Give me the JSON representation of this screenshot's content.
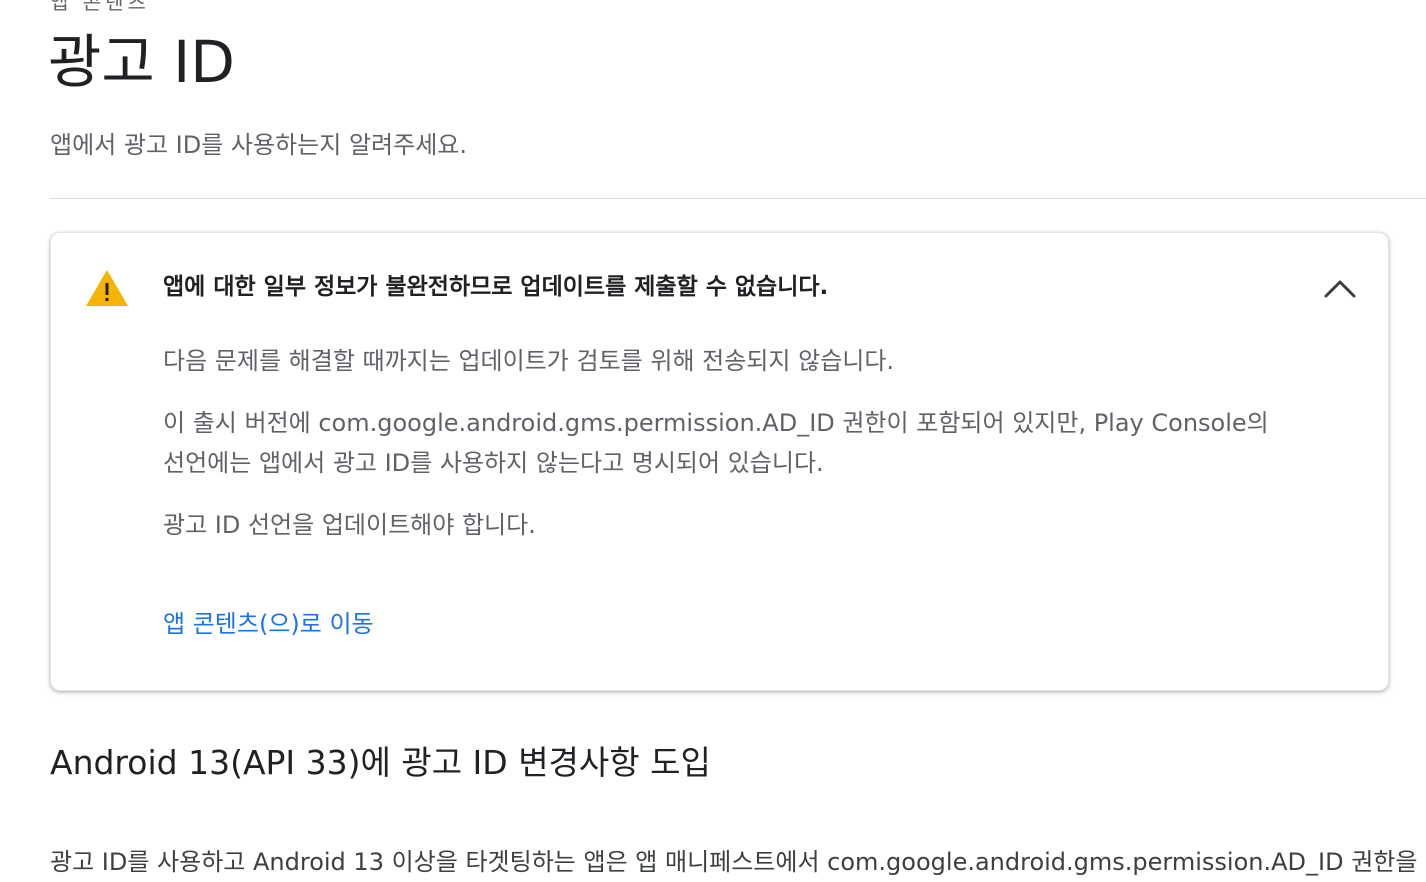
{
  "breadcrumb": {
    "label": "앱 콘텐츠"
  },
  "header": {
    "title": "광고 ID",
    "subtitle": "앱에서 광고 ID를 사용하는지 알려주세요."
  },
  "warning": {
    "icon": "warning-icon",
    "icon_color": "#f4b400",
    "title": "앱에 대한 일부 정보가 불완전하므로 업데이트를 제출할 수 없습니다.",
    "paragraphs": [
      "다음 문제를 해결할 때까지는 업데이트가 검토를 위해 전송되지 않습니다.",
      "이 출시 버전에 com.google.android.gms.permission.AD_ID 권한이 포함되어 있지만, Play Console의 선언에는 앱에서 광고 ID를 사용하지 않는다고 명시되어 있습니다.",
      "광고 ID 선언을 업데이트해야 합니다."
    ],
    "link_label": "앱 콘텐츠(으)로 이동",
    "link_color": "#1a73e8",
    "collapse_icon": "chevron-up-icon"
  },
  "section": {
    "heading": "Android 13(API 33)에 광고 ID 변경사항 도입",
    "text": "광고 ID를 사용하고 Android 13 이상을 타겟팅하는 앱은 앱 매니페스트에서 com.google.android.gms.permission.AD_ID 권한을 선언해야 합니다."
  }
}
